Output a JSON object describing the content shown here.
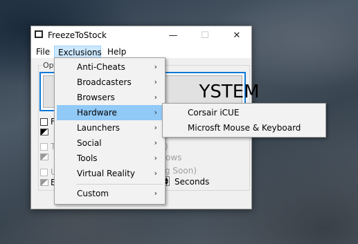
{
  "window": {
    "title": "FreezeToStock",
    "controls": {
      "minimize": "—",
      "maximize": "☐",
      "close": "✕"
    }
  },
  "menubar": [
    "File",
    "Exclusions",
    "Help"
  ],
  "main_button": {
    "label": "YSTEM"
  },
  "group": {
    "label": "Opti"
  },
  "partial": {
    "f_label": "F",
    "t_label": "T",
    "u_label": "U",
    "e_label": "E",
    "paren": ")",
    "ows": "ows",
    "soon": "g Soon)",
    "seconds": "Seconds"
  },
  "exclusions_menu": {
    "items": [
      {
        "label": "Anti-Cheats",
        "submenu": true
      },
      {
        "label": "Broadcasters",
        "submenu": true
      },
      {
        "label": "Browsers",
        "submenu": true
      },
      {
        "label": "Hardware",
        "submenu": true,
        "highlighted": true
      },
      {
        "label": "Launchers",
        "submenu": true
      },
      {
        "label": "Social",
        "submenu": true
      },
      {
        "label": "Tools",
        "submenu": true
      },
      {
        "label": "Virtual Reality",
        "submenu": true
      },
      {
        "label": "Custom",
        "submenu": true
      }
    ],
    "arrow": "›"
  },
  "hardware_submenu": {
    "items": [
      "Corsair iCUE",
      "Microsft Mouse & Keyboard"
    ]
  }
}
